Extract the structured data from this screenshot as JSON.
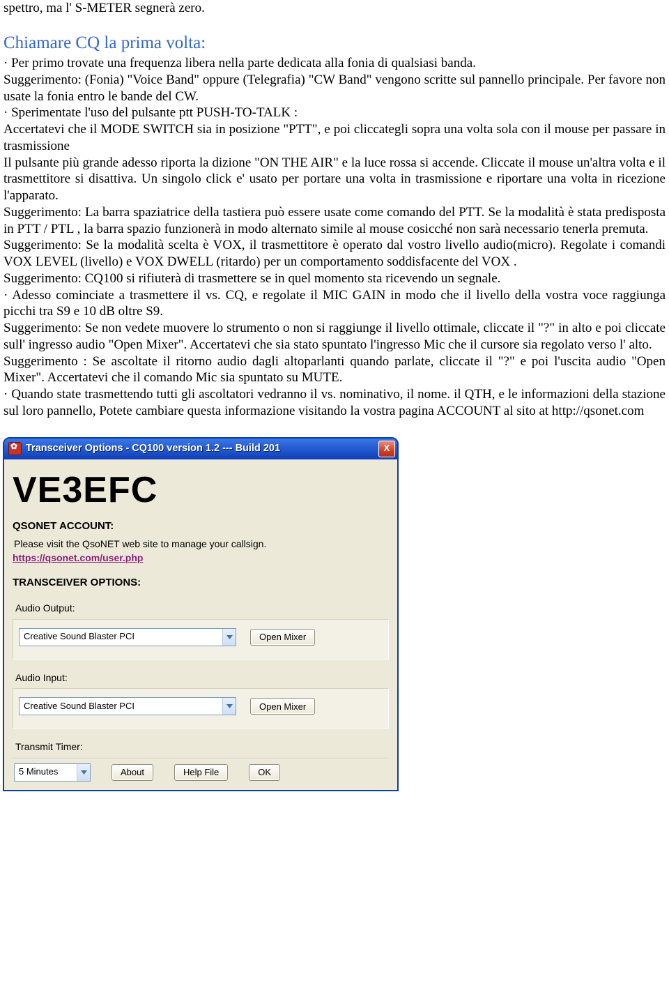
{
  "doc": {
    "intro": "spettro, ma l' S-METER segnerà zero.",
    "heading": "Chiamare CQ la prima volta:",
    "body": "· Per primo trovate una frequenza libera nella parte dedicata alla fonia  di qualsiasi banda.\nSuggerimento: (Fonia) \"Voice Band\" oppure (Telegrafia) \"CW Band\" vengono scritte sul pannello principale.  Per favore non usate la fonia entro le bande del CW.\n· Sperimentate l'uso del pulsante ptt  PUSH-TO-TALK :\nAccertatevi che il  MODE SWITCH sia in posizione \"PTT\", e poi cliccategli sopra una volta sola con il mouse per passare in trasmissione\n Il pulsante più grande adesso riporta la dizione  \"ON THE AIR\" e la luce rossa si accende.  Cliccate il mouse un'altra volta e il trasmettitore si disattiva.  Un singolo click e' usato per portare una volta in trasmissione e riportare una volta in ricezione l'apparato.\nSuggerimento: La barra spaziatrice della tastiera può essere usate come comando del PTT. Se la modalità è stata predisposta in PTT / PTL , la barra spazio funzionerà in modo alternato simile al mouse cosicché non sarà necessario tenerla premuta.\nSuggerimento: Se la modalità scelta è VOX, il trasmettitore è operato dal vostro livello audio(micro).  Regolate i comandi VOX LEVEL (livello) e VOX DWELL (ritardo)  per un comportamento soddisfacente del VOX .\nSuggerimento: CQ100  si rifiuterà di trasmettere se in quel momento sta ricevendo un segnale.\n· Adesso cominciate a trasmettere il vs.  CQ,  e regolate il MIC GAIN in modo che il livello della vostra voce raggiunga picchi tra S9 e 10 dB oltre S9.\nSuggerimento: Se non vedete muovere lo strumento o non si raggiunge il livello ottimale,  cliccate il \"?\" in alto e poi cliccate sull' ingresso audio  \"Open Mixer\".  Accertatevi che sia stato spuntato l'ingresso Mic che il cursore sia regolato verso l' alto.\nSuggerimento : Se ascoltate il ritorno audio dagli altoparlanti quando parlate, cliccate il  \"?\"  e poi l'uscita audio  \"Open Mixer\".  Accertatevi che il comando  Mic sia spuntato su  MUTE.\n· Quando state trasmettendo tutti gli ascoltatori vedranno il vs.  nominativo, il nome.  il  QTH, e le informazioni della stazione sul loro pannello,  Potete cambiare questa informazione visitando la vostra pagina  ACCOUNT al sito at http://qsonet.com"
  },
  "dialog": {
    "title": "Transceiver  Options - CQ100 version 1.2 ---  Build 201",
    "close": "X",
    "callsign": "VE3EFC",
    "account": {
      "heading": "QSONET ACCOUNT:",
      "text": "Please visit the QsoNET web site to manage your callsign.",
      "link": "https://qsonet.com/user.php"
    },
    "options_heading": "TRANSCEIVER OPTIONS:",
    "audio_out": {
      "label": "Audio Output:",
      "value": "Creative Sound Blaster PCI",
      "button": "Open Mixer"
    },
    "audio_in": {
      "label": "Audio Input:",
      "value": "Creative Sound Blaster PCI",
      "button": "Open Mixer"
    },
    "timer": {
      "label": "Transmit Timer:",
      "value": "5   Minutes"
    },
    "buttons": {
      "about": "About",
      "help": "Help File",
      "ok": "OK"
    }
  }
}
